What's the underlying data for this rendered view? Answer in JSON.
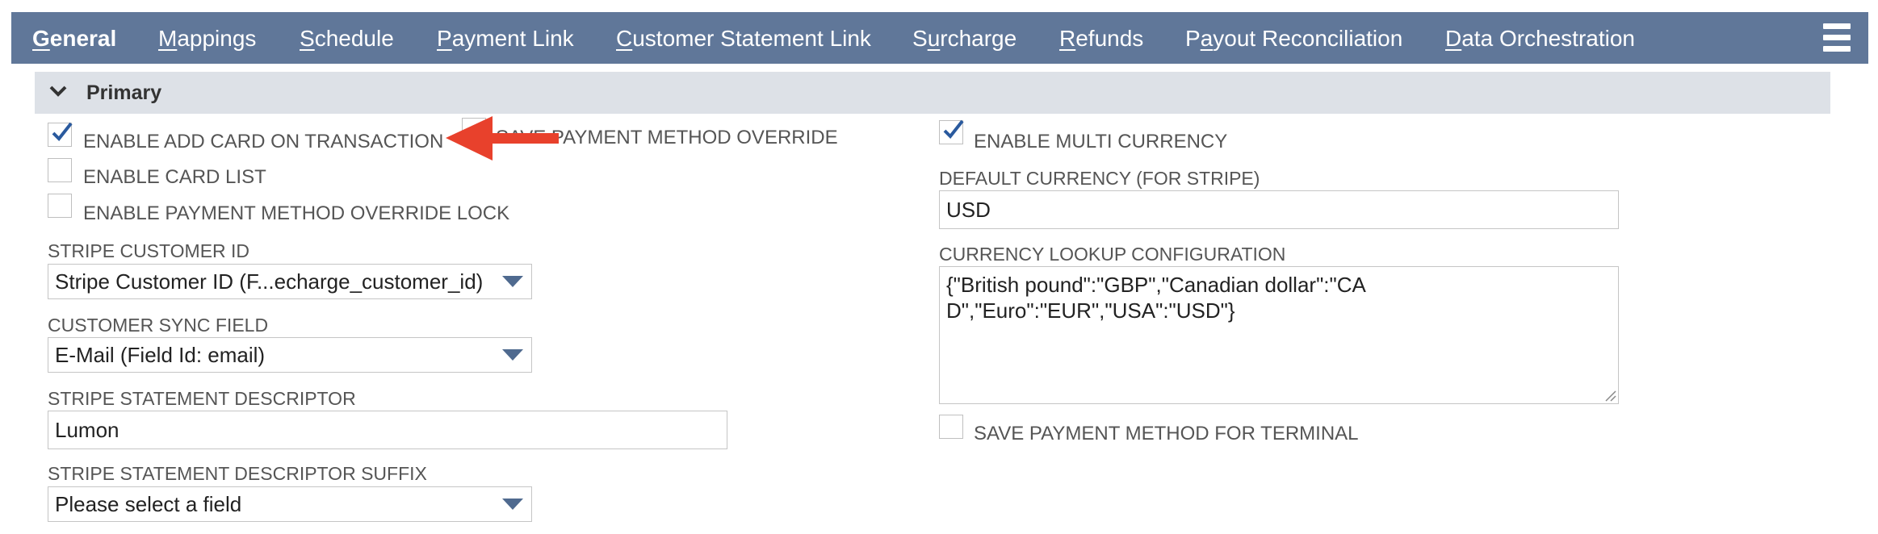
{
  "tabs": [
    {
      "pre": "",
      "key": "G",
      "post": "eneral",
      "active": true
    },
    {
      "pre": "",
      "key": "M",
      "post": "appings",
      "active": false
    },
    {
      "pre": "",
      "key": "S",
      "post": "chedule",
      "active": false
    },
    {
      "pre": "",
      "key": "P",
      "post": "ayment Link",
      "active": false
    },
    {
      "pre": "",
      "key": "C",
      "post": "ustomer Statement Link",
      "active": false
    },
    {
      "pre": "S",
      "key": "u",
      "post": "rcharge",
      "active": false
    },
    {
      "pre": "",
      "key": "R",
      "post": "efunds",
      "active": false
    },
    {
      "pre": "P",
      "key": "a",
      "post": "yout Reconciliation",
      "active": false
    },
    {
      "pre": "",
      "key": "D",
      "post": "ata Orchestration",
      "active": false
    }
  ],
  "menu_icon": "hamburger-menu-icon",
  "section": {
    "title": "Primary",
    "icon": "chevron-down-icon"
  },
  "left": {
    "enable_add_card": {
      "label": "ENABLE ADD CARD ON TRANSACTION",
      "checked": true
    },
    "save_payment_override": {
      "label": "SAVE PAYMENT METHOD OVERRIDE",
      "checked": false
    },
    "enable_card_list": {
      "label": "ENABLE CARD LIST",
      "checked": false
    },
    "enable_override_lock": {
      "label": "ENABLE PAYMENT METHOD OVERRIDE LOCK",
      "checked": false
    },
    "stripe_customer_id": {
      "label": "STRIPE CUSTOMER ID",
      "value": "Stripe Customer ID (F...echarge_customer_id)"
    },
    "customer_sync_field": {
      "label": "CUSTOMER SYNC FIELD",
      "value": "E-Mail (Field Id: email)"
    },
    "statement_descriptor": {
      "label": "STRIPE STATEMENT DESCRIPTOR",
      "value": "Lumon"
    },
    "statement_descriptor_suffix": {
      "label": "STRIPE STATEMENT DESCRIPTOR SUFFIX",
      "value": "Please select a field"
    }
  },
  "right": {
    "enable_multi_currency": {
      "label": "ENABLE MULTI CURRENCY",
      "checked": true
    },
    "default_currency": {
      "label": "DEFAULT CURRENCY (FOR STRIPE)",
      "value": "USD"
    },
    "currency_lookup": {
      "label": "CURRENCY LOOKUP CONFIGURATION",
      "value": "{\"British pound\":\"GBP\",\"Canadian dollar\":\"CAD\",\"Euro\":\"EUR\",\"USA\":\"USD\"}"
    },
    "save_payment_terminal": {
      "label": "SAVE PAYMENT METHOD FOR TERMINAL",
      "checked": false
    }
  },
  "colors": {
    "tabbar": "#607799",
    "section": "#dde1e7",
    "check": "#2a5a9e",
    "arrow": "#e8412c"
  }
}
